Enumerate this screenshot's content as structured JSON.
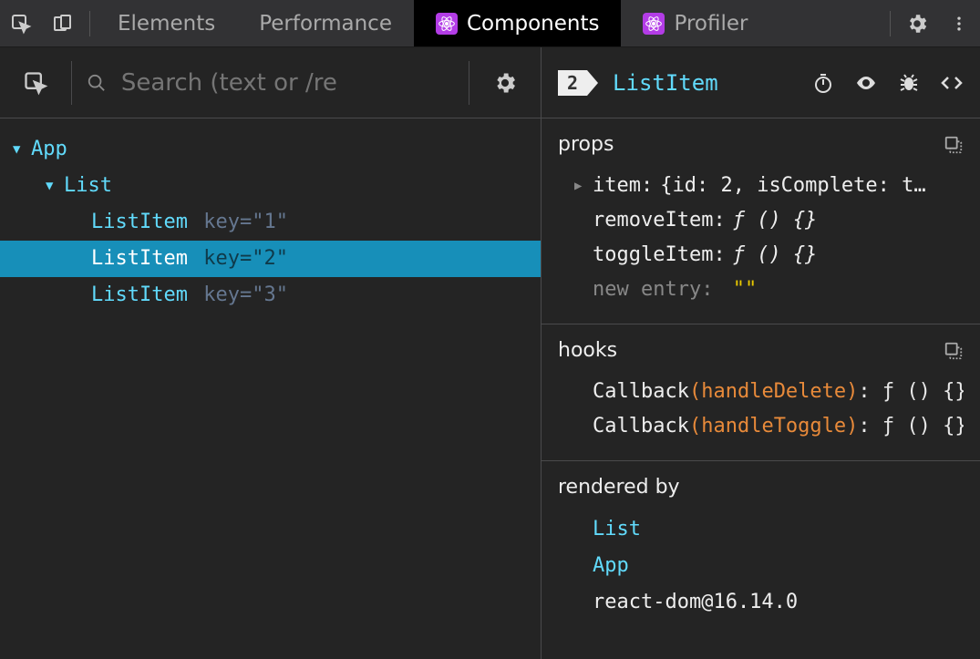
{
  "tabbar": {
    "tabs": [
      {
        "id": "elements",
        "label": "Elements"
      },
      {
        "id": "performance",
        "label": "Performance"
      },
      {
        "id": "components",
        "label": "Components"
      },
      {
        "id": "profiler",
        "label": "Profiler"
      }
    ],
    "active": "components"
  },
  "search": {
    "placeholder": "Search (text or /re"
  },
  "tree": {
    "nodes": [
      {
        "name": "App",
        "depth": 1,
        "expandable": true
      },
      {
        "name": "List",
        "depth": 2,
        "expandable": true
      },
      {
        "name": "ListItem",
        "depth": 3,
        "key": "1"
      },
      {
        "name": "ListItem",
        "depth": 3,
        "key": "2",
        "selected": true
      },
      {
        "name": "ListItem",
        "depth": 3,
        "key": "3"
      }
    ]
  },
  "selected": {
    "badge": "2",
    "name": "ListItem"
  },
  "props": {
    "title": "props",
    "rows": [
      {
        "name": "item",
        "value": "{id: 2, isComplete: t…",
        "expandable": true
      },
      {
        "name": "removeItem",
        "value": "ƒ () {}"
      },
      {
        "name": "toggleItem",
        "value": "ƒ () {}"
      }
    ],
    "newEntry": {
      "label": "new entry",
      "value": "\"\""
    }
  },
  "hooks": {
    "title": "hooks",
    "rows": [
      {
        "callback": "Callback",
        "arg": "handleDelete",
        "value": "ƒ () {}"
      },
      {
        "callback": "Callback",
        "arg": "handleToggle",
        "value": "ƒ () {}"
      }
    ]
  },
  "renderedBy": {
    "title": "rendered by",
    "items": [
      {
        "label": "List",
        "link": true
      },
      {
        "label": "App",
        "link": true
      },
      {
        "label": "react-dom@16.14.0",
        "link": false
      }
    ]
  }
}
